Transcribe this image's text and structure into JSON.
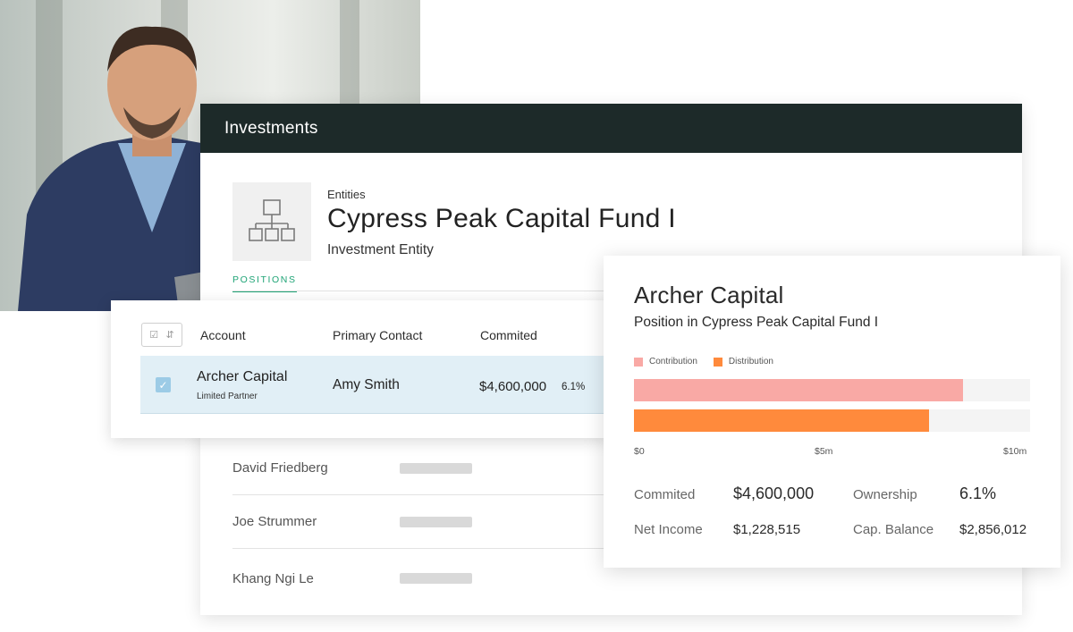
{
  "header": {
    "title": "Investments"
  },
  "entity": {
    "breadcrumb": "Entities",
    "name": "Cypress Peak Capital Fund I",
    "type": "Investment Entity",
    "icon": "org-chart-icon"
  },
  "tabs": [
    {
      "label": "POSITIONS",
      "active": true
    }
  ],
  "table": {
    "columns": [
      "Account",
      "Primary Contact",
      "Commited"
    ],
    "selected_row": {
      "account": "Archer Capital",
      "account_sub": "Limited Partner",
      "contact": "Amy Smith",
      "committed": "$4,600,000",
      "percent": "6.1%",
      "checked": true
    },
    "other_rows": [
      {
        "name": "David Friedberg"
      },
      {
        "name": "Joe Strummer"
      },
      {
        "name": "Khang Ngi Le"
      }
    ]
  },
  "position_card": {
    "title": "Archer Capital",
    "subtitle": "Position in Cypress Peak Capital Fund I",
    "stats": {
      "committed_label": "Commited",
      "committed_value": "$4,600,000",
      "ownership_label": "Ownership",
      "ownership_value": "6.1%",
      "net_income_label": "Net Income",
      "net_income_value": "$1,228,515",
      "cap_balance_label": "Cap. Balance",
      "cap_balance_value": "$2,856,012"
    }
  },
  "chart_data": {
    "type": "bar",
    "orientation": "horizontal",
    "series": [
      {
        "name": "Contribution",
        "values": [
          8.3
        ],
        "color": "#f9a9a5"
      },
      {
        "name": "Distribution",
        "values": [
          7.45
        ],
        "color": "#ff8a3c"
      }
    ],
    "xlim": [
      0,
      10
    ],
    "ticks": [
      "$0",
      "$5m",
      "$10m"
    ],
    "legend": "top-left",
    "grid": false
  },
  "colors": {
    "header_bg": "#1d2a29",
    "accent": "#1fa476",
    "selected_row_bg": "#e1eff6",
    "checkbox": "#9ccbe6"
  }
}
